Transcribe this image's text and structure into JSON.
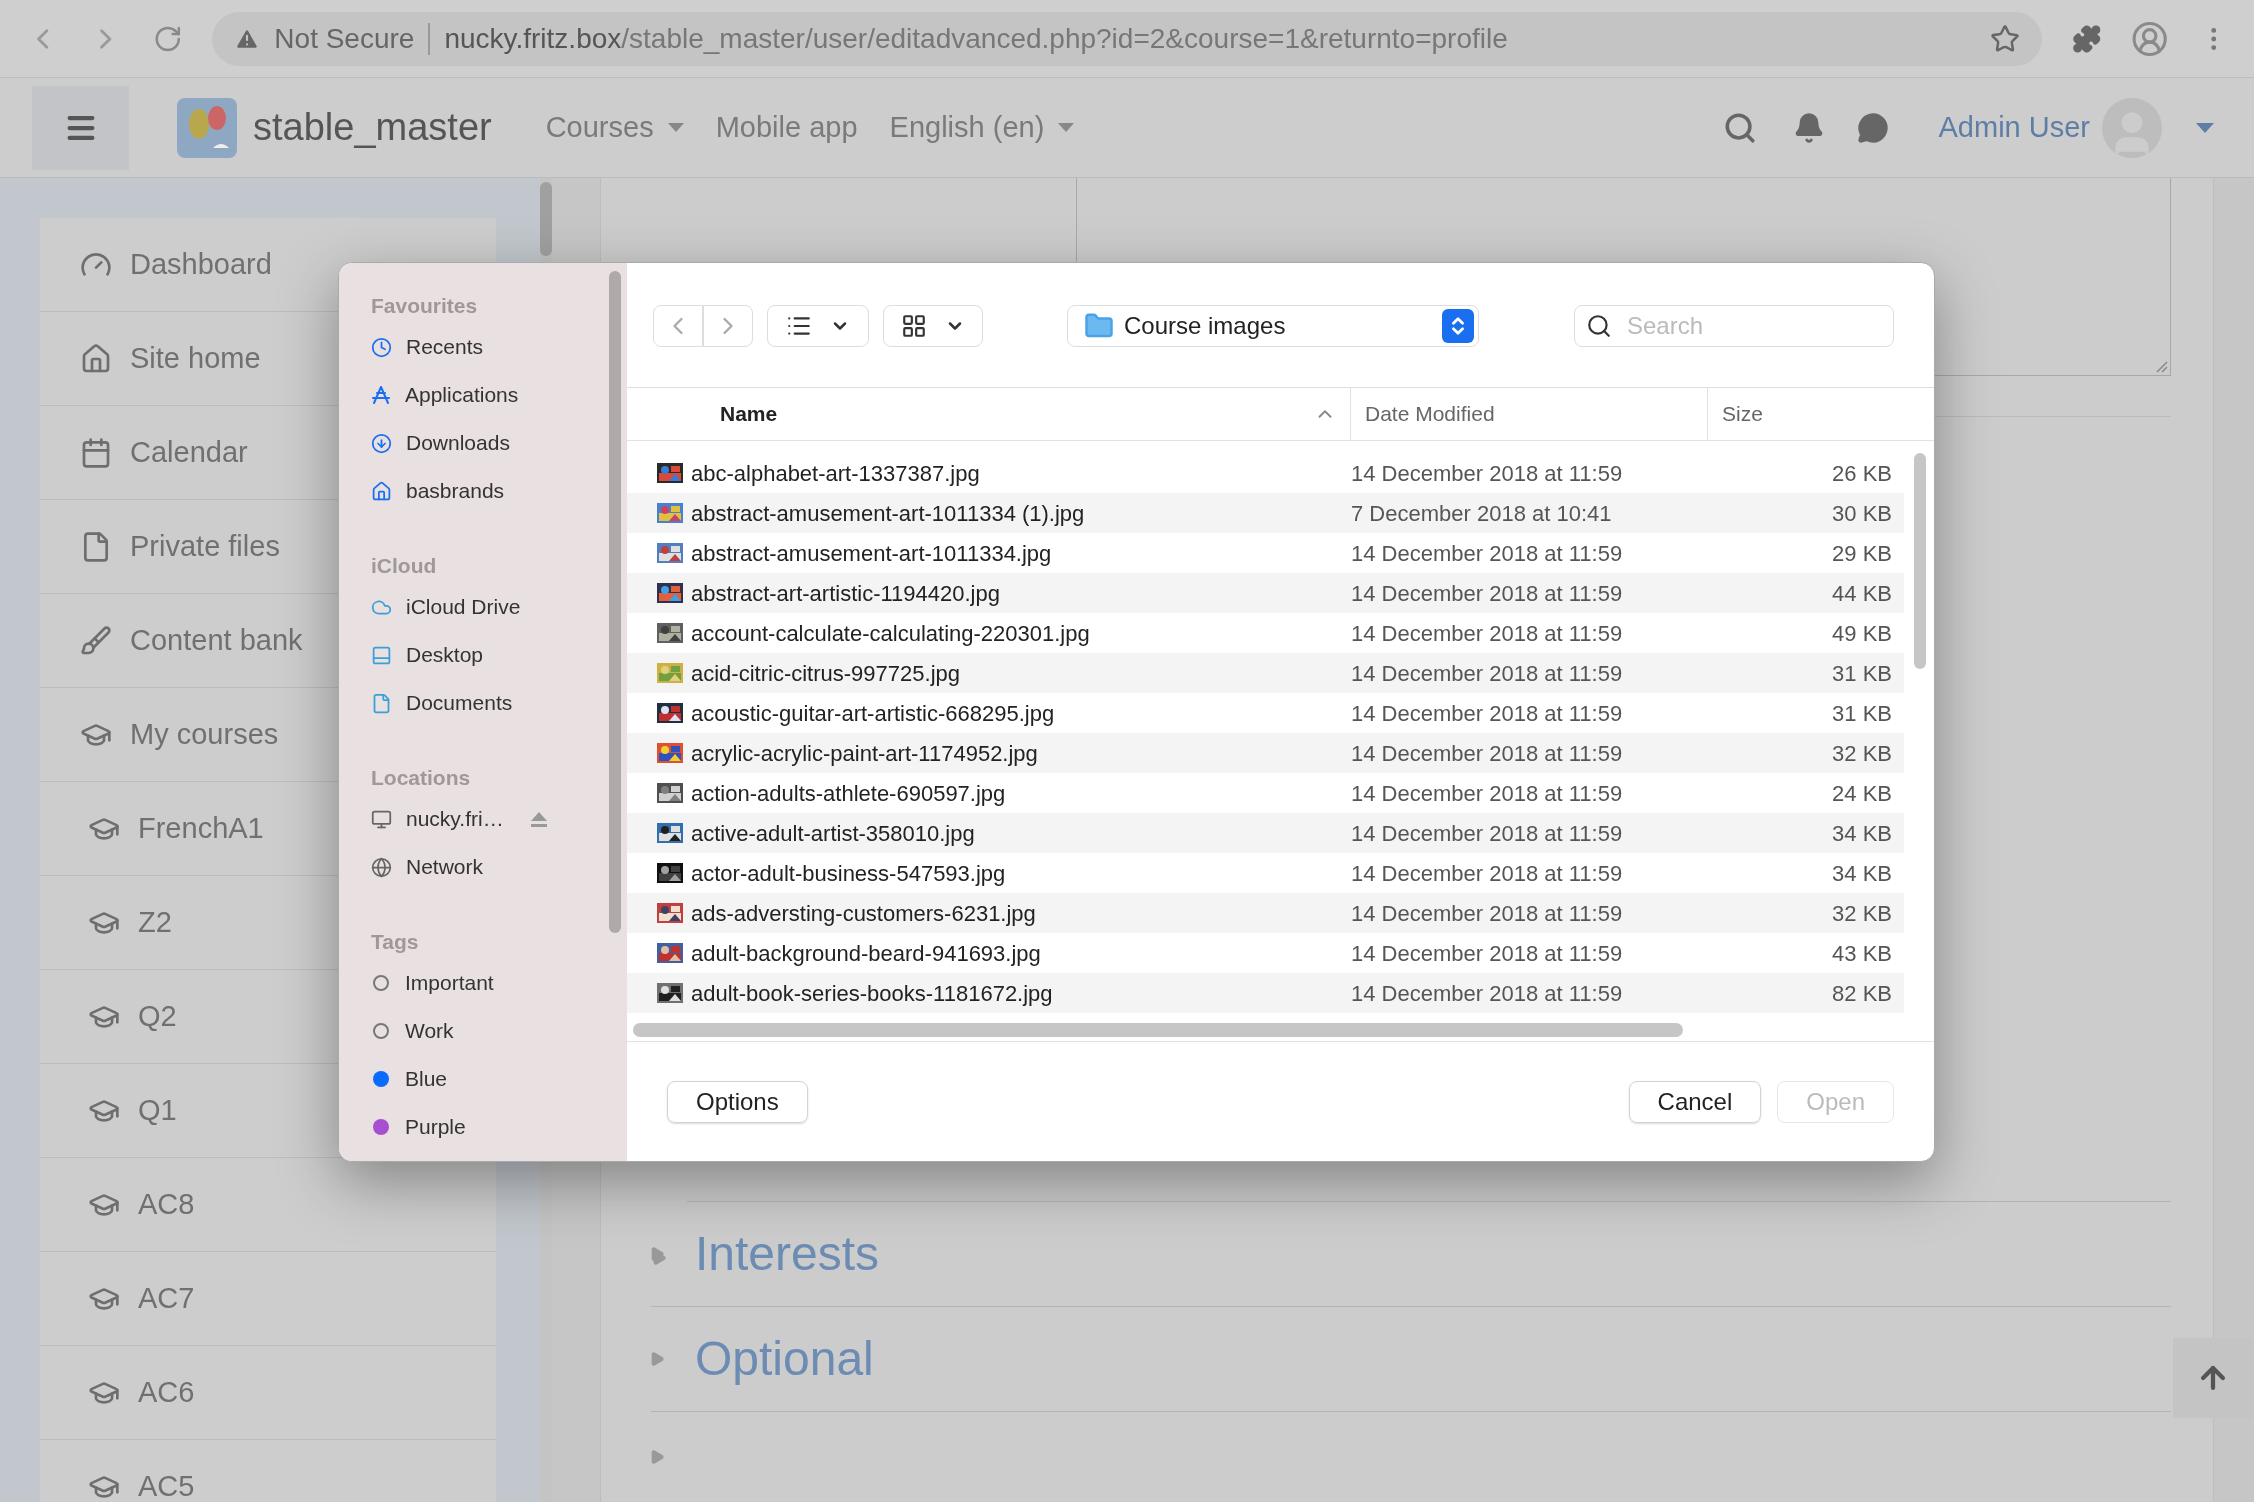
{
  "browser": {
    "security": "Not Secure",
    "url_host": "nucky.fritz.box",
    "url_path": "/stable_master/user/editadvanced.php?id=2&course=1&returnto=profile"
  },
  "navbar": {
    "brand": "stable_master",
    "menu": [
      {
        "label": "Courses",
        "dropdown": true
      },
      {
        "label": "Mobile app",
        "dropdown": false
      },
      {
        "label": "English (en)",
        "dropdown": true
      }
    ],
    "user": "Admin User"
  },
  "sidebar": {
    "items": [
      {
        "label": "Dashboard",
        "kind": "dashboard"
      },
      {
        "label": "Site home",
        "kind": "home"
      },
      {
        "label": "Calendar",
        "kind": "calendar"
      },
      {
        "label": "Private files",
        "kind": "file"
      },
      {
        "label": "Content bank",
        "kind": "brush"
      },
      {
        "label": "My courses",
        "kind": "courses"
      },
      {
        "label": "FrenchA1",
        "kind": "course"
      },
      {
        "label": "Z2",
        "kind": "course"
      },
      {
        "label": "Q2",
        "kind": "course"
      },
      {
        "label": "Q1",
        "kind": "course"
      },
      {
        "label": "AC8",
        "kind": "course"
      },
      {
        "label": "AC7",
        "kind": "course"
      },
      {
        "label": "AC6",
        "kind": "course"
      },
      {
        "label": "AC5",
        "kind": "course"
      }
    ]
  },
  "sections": [
    {
      "label": "Interests"
    },
    {
      "label": "Optional"
    }
  ],
  "dialog": {
    "sidebar": [
      {
        "title": "Favourites",
        "items": [
          {
            "label": "Recents",
            "kind": "clock"
          },
          {
            "label": "Applications",
            "kind": "apps"
          },
          {
            "label": "Downloads",
            "kind": "download"
          },
          {
            "label": "basbrands",
            "kind": "home"
          }
        ]
      },
      {
        "title": "iCloud",
        "items": [
          {
            "label": "iCloud Drive",
            "kind": "cloud"
          },
          {
            "label": "Desktop",
            "kind": "desktop"
          },
          {
            "label": "Documents",
            "kind": "document"
          }
        ]
      },
      {
        "title": "Locations",
        "items": [
          {
            "label": "nucky.fri…",
            "kind": "computer",
            "ejectable": true
          },
          {
            "label": "Network",
            "kind": "globe"
          }
        ]
      },
      {
        "title": "Tags",
        "items": [
          {
            "label": "Important",
            "kind": "tag"
          },
          {
            "label": "Work",
            "kind": "tag"
          },
          {
            "label": "Blue",
            "kind": "tag",
            "color": "#0a6cff"
          },
          {
            "label": "Purple",
            "kind": "tag",
            "color": "#a64fd1"
          }
        ]
      }
    ],
    "location": "Course images",
    "search": {
      "placeholder": "Search"
    },
    "columns": [
      {
        "label": "Name",
        "sorted": true
      },
      {
        "label": "Date Modified",
        "sorted": false
      },
      {
        "label": "Size",
        "sorted": false
      }
    ],
    "files": [
      {
        "name": "abc-alphabet-art-1337387.jpg",
        "date": "14 December 2018 at 11:59",
        "size": "26 KB"
      },
      {
        "name": "abstract-amusement-art-1011334 (1).jpg",
        "date": "7 December 2018 at 10:41",
        "size": "30 KB"
      },
      {
        "name": "abstract-amusement-art-1011334.jpg",
        "date": "14 December 2018 at 11:59",
        "size": "29 KB"
      },
      {
        "name": "abstract-art-artistic-1194420.jpg",
        "date": "14 December 2018 at 11:59",
        "size": "44 KB"
      },
      {
        "name": "account-calculate-calculating-220301.jpg",
        "date": "14 December 2018 at 11:59",
        "size": "49 KB"
      },
      {
        "name": "acid-citric-citrus-997725.jpg",
        "date": "14 December 2018 at 11:59",
        "size": "31 KB"
      },
      {
        "name": "acoustic-guitar-art-artistic-668295.jpg",
        "date": "14 December 2018 at 11:59",
        "size": "31 KB"
      },
      {
        "name": "acrylic-acrylic-paint-art-1174952.jpg",
        "date": "14 December 2018 at 11:59",
        "size": "32 KB"
      },
      {
        "name": "action-adults-athlete-690597.jpg",
        "date": "14 December 2018 at 11:59",
        "size": "24 KB"
      },
      {
        "name": "active-adult-artist-358010.jpg",
        "date": "14 December 2018 at 11:59",
        "size": "34 KB"
      },
      {
        "name": "actor-adult-business-547593.jpg",
        "date": "14 December 2018 at 11:59",
        "size": "34 KB"
      },
      {
        "name": "ads-adversting-customers-6231.jpg",
        "date": "14 December 2018 at 11:59",
        "size": "32 KB"
      },
      {
        "name": "adult-background-beard-941693.jpg",
        "date": "14 December 2018 at 11:59",
        "size": "43 KB"
      },
      {
        "name": "adult-book-series-books-1181672.jpg",
        "date": "14 December 2018 at 11:59",
        "size": "82 KB"
      }
    ],
    "buttons": [
      {
        "label": "Options",
        "disabled": false
      },
      {
        "label": "Cancel",
        "disabled": false
      },
      {
        "label": "Open",
        "disabled": true
      }
    ]
  }
}
